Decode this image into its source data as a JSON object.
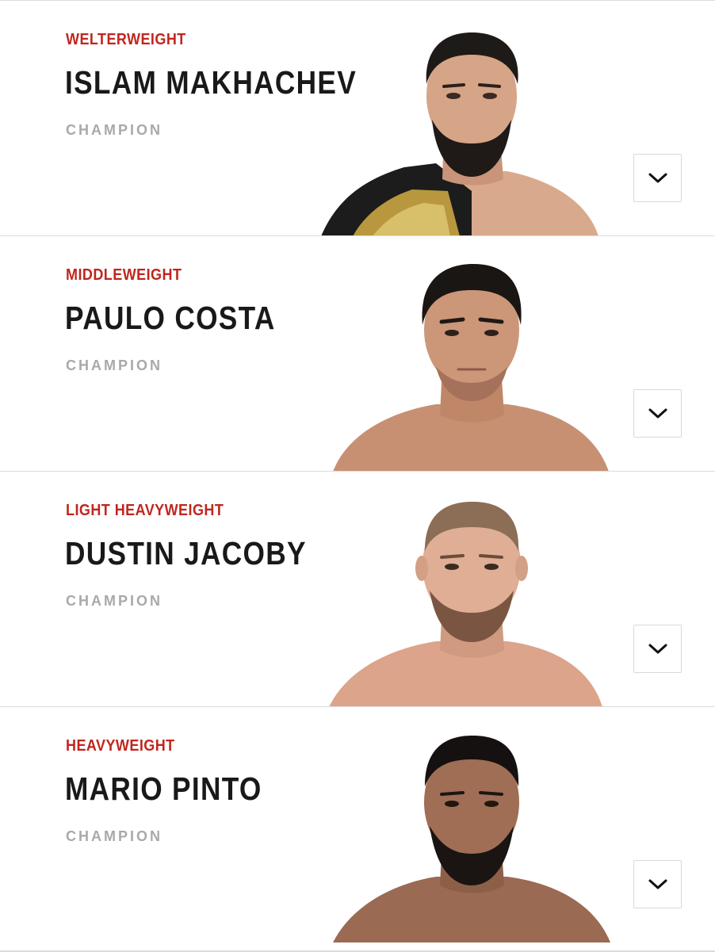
{
  "rankings": [
    {
      "division": "WELTERWEIGHT",
      "name": "ISLAM MAKHACHEV",
      "rank": "CHAMPION",
      "photo": "fighter-portrait-with-belt",
      "expand_icon": "chevron-down-icon"
    },
    {
      "division": "MIDDLEWEIGHT",
      "name": "PAULO COSTA",
      "rank": "CHAMPION",
      "photo": "fighter-portrait",
      "expand_icon": "chevron-down-icon"
    },
    {
      "division": "LIGHT HEAVYWEIGHT",
      "name": "DUSTIN JACOBY",
      "rank": "CHAMPION",
      "photo": "fighter-portrait",
      "expand_icon": "chevron-down-icon"
    },
    {
      "division": "HEAVYWEIGHT",
      "name": "MARIO PINTO",
      "rank": "CHAMPION",
      "photo": "fighter-portrait",
      "expand_icon": "chevron-down-icon"
    }
  ],
  "colors": {
    "division": "#c0261f",
    "name": "#191919",
    "rank": "#a9a9a9",
    "divider": "#dcdcdc"
  }
}
